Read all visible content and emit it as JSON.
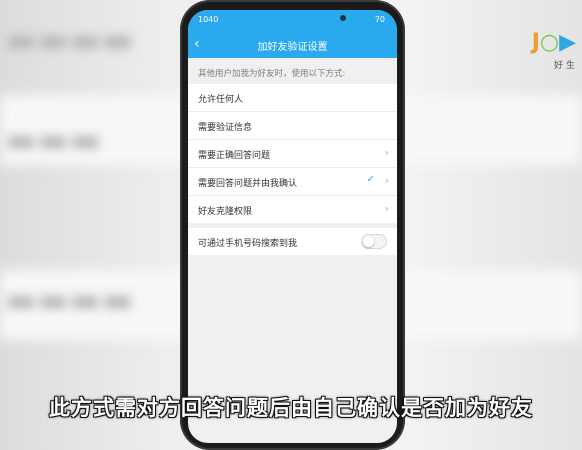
{
  "status_bar": {
    "time": "1040",
    "battery": "70"
  },
  "nav": {
    "title": "加好友验证设置"
  },
  "hint": "其他用户加我为好友时，使用以下方式:",
  "options": [
    {
      "label": "允许任何人",
      "checked": false,
      "chevron": false
    },
    {
      "label": "需要验证信息",
      "checked": false,
      "chevron": false
    },
    {
      "label": "需要正确回答问题",
      "checked": false,
      "chevron": true
    },
    {
      "label": "需要回答问题并由我确认",
      "checked": true,
      "chevron": true
    },
    {
      "label": "好友克隆权限",
      "checked": false,
      "chevron": true
    }
  ],
  "phone_search": {
    "label": "可通过手机号码搜索到我",
    "enabled": false
  },
  "logo": {
    "sub": "好生"
  },
  "caption": "此方式需对方回答问题后由自己确认是否加为好友",
  "colors": {
    "accent": "#2aa9ee"
  }
}
